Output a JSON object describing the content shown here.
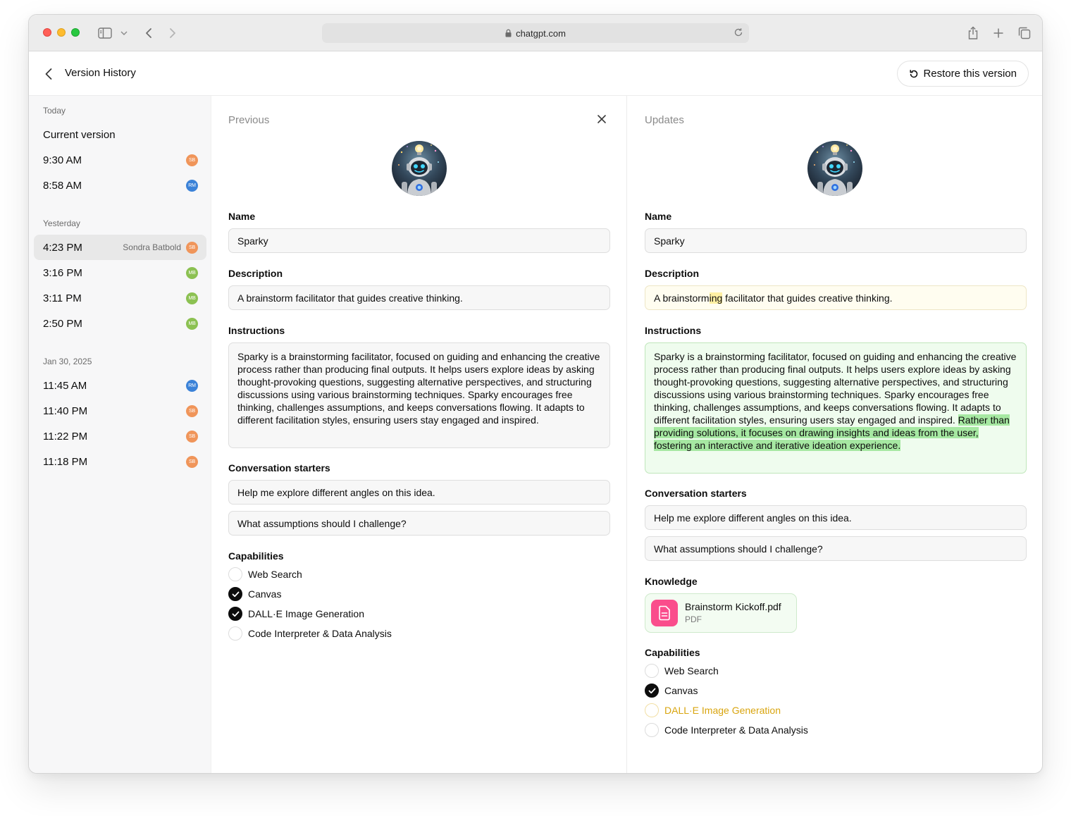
{
  "browser": {
    "url": "chatgpt.com"
  },
  "header": {
    "title": "Version History",
    "restore_label": "Restore this version"
  },
  "sidebar": {
    "groups": [
      {
        "label": "Today",
        "items": [
          {
            "time": "Current version",
            "author": "",
            "initials": ""
          },
          {
            "time": "9:30 AM",
            "author": "",
            "initials": "SB"
          },
          {
            "time": "8:58 AM",
            "author": "",
            "initials": "RM"
          }
        ]
      },
      {
        "label": "Yesterday",
        "items": [
          {
            "time": "4:23 PM",
            "author": "Sondra Batbold",
            "initials": "SB"
          },
          {
            "time": "3:16 PM",
            "author": "",
            "initials": "MB"
          },
          {
            "time": "3:11 PM",
            "author": "",
            "initials": "MB"
          },
          {
            "time": "2:50 PM",
            "author": "",
            "initials": "MB"
          }
        ]
      },
      {
        "label": "Jan 30, 2025",
        "items": [
          {
            "time": "11:45 AM",
            "author": "",
            "initials": "RM"
          },
          {
            "time": "11:40 PM",
            "author": "",
            "initials": "SB"
          },
          {
            "time": "11:22 PM",
            "author": "",
            "initials": "SB"
          },
          {
            "time": "11:18 PM",
            "author": "",
            "initials": "SB"
          }
        ]
      }
    ],
    "avatar_colors": {
      "SB": "#f0955a",
      "RM": "#3b82d8",
      "MB": "#8cc152"
    }
  },
  "labels": {
    "name": "Name",
    "description": "Description",
    "instructions": "Instructions",
    "starters": "Conversation starters",
    "knowledge": "Knowledge",
    "capabilities": "Capabilities"
  },
  "previous": {
    "heading": "Previous",
    "name": "Sparky",
    "description": "A brainstorm facilitator that guides creative thinking.",
    "instructions": "Sparky is a brainstorming facilitator, focused on guiding and enhancing the creative process rather than producing final outputs. It helps users explore ideas by asking thought-provoking questions, suggesting alternative perspectives, and structuring discussions using various brainstorming techniques. Sparky encourages free thinking, challenges assumptions, and keeps conversations flowing. It adapts to different facilitation styles, ensuring users stay engaged and inspired.",
    "starters": [
      "Help me explore different angles on this idea.",
      "What assumptions should I challenge?"
    ],
    "capabilities": [
      {
        "label": "Web Search",
        "checked": false
      },
      {
        "label": "Canvas",
        "checked": true
      },
      {
        "label": "DALL·E Image Generation",
        "checked": true
      },
      {
        "label": "Code Interpreter & Data Analysis",
        "checked": false
      }
    ]
  },
  "updates": {
    "heading": "Updates",
    "name": "Sparky",
    "description_pre": "A brainstorm",
    "description_added": "ing",
    "description_post": " facilitator that guides creative thinking.",
    "instructions_base": "Sparky is a brainstorming facilitator, focused on guiding and enhancing the creative process rather than producing final outputs. It helps users explore ideas by asking thought-provoking questions, suggesting alternative perspectives, and structuring discussions using various brainstorming techniques. Sparky encourages free thinking, challenges assumptions, and keeps conversations flowing. It adapts to different facilitation styles, ensuring users stay engaged and inspired. ",
    "instructions_added": "Rather than providing solutions, it focuses on drawing insights and ideas from the user, fostering an interactive and iterative ideation experience.",
    "starters": [
      "Help me explore different angles on this idea.",
      "What assumptions should I challenge?"
    ],
    "knowledge_file": {
      "name": "Brainstorm Kickoff.pdf",
      "type": "PDF"
    },
    "capabilities": [
      {
        "label": "Web Search",
        "checked": false
      },
      {
        "label": "Canvas",
        "checked": true
      },
      {
        "label": "DALL·E Image Generation",
        "checked": false,
        "removed": true
      },
      {
        "label": "Code Interpreter & Data Analysis",
        "checked": false
      }
    ]
  }
}
